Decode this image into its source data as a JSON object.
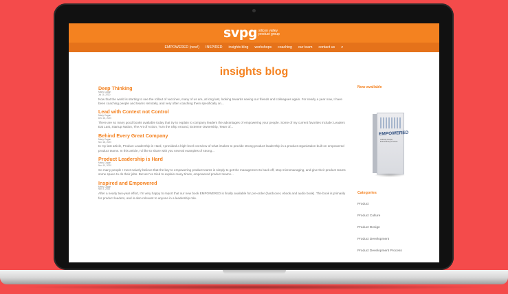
{
  "site": {
    "logo_mark": "svpg",
    "logo_tagline": "silicon valley product group"
  },
  "nav": {
    "items": [
      {
        "label": "EMPOWERED (new!)"
      },
      {
        "label": "INSPIRED"
      },
      {
        "label": "insights blog"
      },
      {
        "label": "workshops"
      },
      {
        "label": "coaching"
      },
      {
        "label": "our team"
      },
      {
        "label": "contact us"
      }
    ],
    "search_icon": "search-icon"
  },
  "page": {
    "title": "insights blog"
  },
  "posts": [
    {
      "title": "Deep Thinking",
      "author": "Marty Cagan",
      "date": "Jul 14, 2020",
      "excerpt": "Now that the world is starting to see the rollout of vaccines, many of us are, at long last, looking towards seeing our friends and colleagues again. For nearly a year now, I have been coaching people and teams remotely, and very often coaching them specifically on..."
    },
    {
      "title": "Lead with Context not Control",
      "author": "Marty Cagan",
      "date": "Dec 16, 2020",
      "excerpt": "There are so many good books available today that try to explain to company leaders the advantages of empowering your people. Some of my current favorites include: Leaders Eat Last, Startup Nation, The Art of Action, Turn the Ship Around, Extreme Ownership, Team of..."
    },
    {
      "title": "Behind Every Great Company",
      "author": "Marty Cagan",
      "date": "Nov 18, 2020",
      "excerpt": "In my last article, Product Leadership is Hard, I provided a high-level overview of what it takes to provide strong product leadership in a product organization built on empowered product teams. In this article, I'd like to share with you several examples of strong..."
    },
    {
      "title": "Product Leadership is Hard",
      "author": "Marty Cagan",
      "date": "Nov 10, 2020",
      "excerpt": "So many people I meet naively believe that the key to empowering product teams is simply to get the management to back off, stop micromanaging, and give their product teams some space to do their jobs. But as I've tried to explain many times, empowered product teams..."
    },
    {
      "title": "Inspired and Empowered",
      "author": "Marty Cagan",
      "date": "Nov 3, 2020",
      "excerpt": "After a nearly two-year effort, I'm very happy to report that our new book EMPOWERED is finally available for pre-order (hardcover, ebook and audio book). The book is primarily for product leaders, and is also relevant to anyone in a leadership role."
    }
  ],
  "sidebar": {
    "now_available_title": "Now available",
    "book_title": "EMPOWERED",
    "book_subtitle": "Ordinary People, Extraordinary Products",
    "categories_title": "Categories",
    "categories": [
      {
        "label": "Product"
      },
      {
        "label": "Product Culture"
      },
      {
        "label": "Product Design"
      },
      {
        "label": "Product Development"
      },
      {
        "label": "Product Development Process"
      }
    ]
  },
  "colors": {
    "background": "#f44b4b",
    "brand_orange": "#f48220",
    "nav_orange": "#e5721a"
  }
}
